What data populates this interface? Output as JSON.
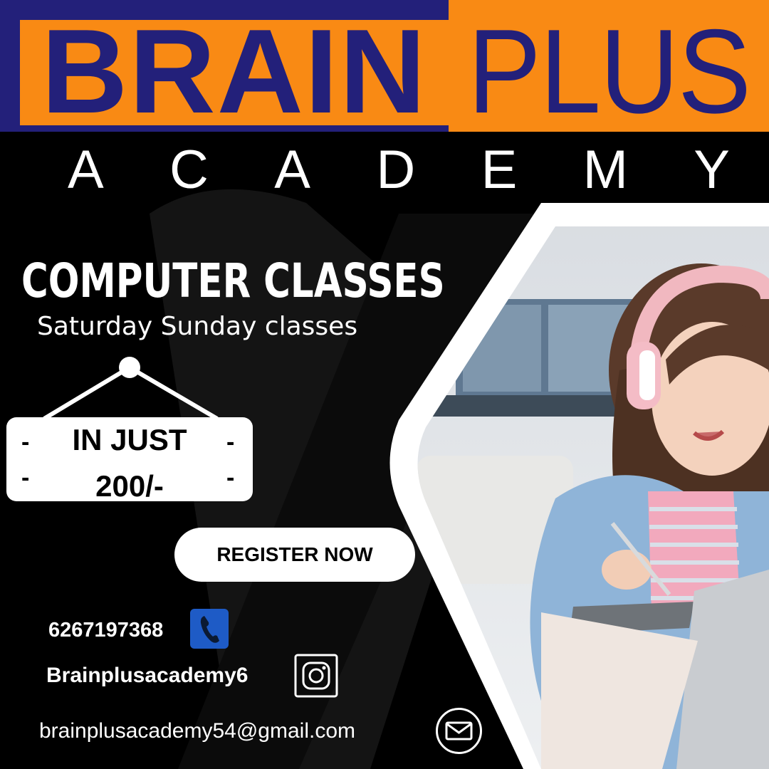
{
  "brand": {
    "word1": "BRAIN",
    "word2": "PLUS",
    "academy_letters": [
      "A",
      "C",
      "A",
      "D",
      "E",
      "M",
      "Y"
    ]
  },
  "course": {
    "title": "COMPUTER CLASSES",
    "schedule": "Saturday Sunday classes"
  },
  "price_sign": {
    "line1": "IN JUST",
    "line2": "200/-"
  },
  "cta": {
    "register_label": "REGISTER NOW"
  },
  "contact": {
    "phone": "6267197368",
    "instagram": "Brainplusacademy6",
    "email": "brainplusacademy54@gmail.com"
  },
  "colors": {
    "navy": "#23207a",
    "orange": "#f98a14",
    "phone_blue": "#1e5bc6",
    "background": "#000000"
  },
  "icons": [
    "phone-icon",
    "instagram-icon",
    "mail-icon"
  ]
}
